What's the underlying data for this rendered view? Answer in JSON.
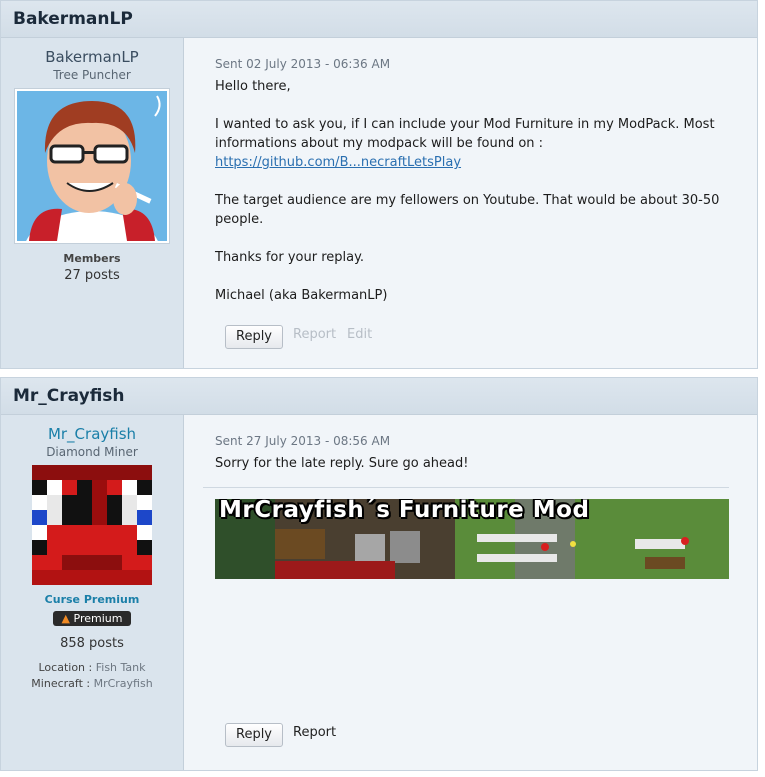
{
  "posts": [
    {
      "header": "BakermanLP",
      "author": {
        "name": "BakermanLP",
        "title": "Tree Puncher",
        "group": "Members",
        "posts": "27 posts"
      },
      "sent": "Sent 02 July 2013 - 06:36 AM",
      "paragraphs": [
        "Hello there,",
        "I wanted to ask you, if I can include your Mod Furniture  in my ModPack. Most informations about my modpack will be found on :",
        "https://github.com/B...necraftLetsPlay",
        "The target audience are my fellowers on Youtube. That would be about 30-50 people.",
        "Thanks for your replay.",
        "Michael (aka BakermanLP)"
      ],
      "actions": {
        "reply": "Reply",
        "report": "Report",
        "edit": "Edit"
      }
    },
    {
      "header": "Mr_Crayfish",
      "author": {
        "name": "Mr_Crayfish",
        "title": "Diamond Miner",
        "group": "Curse Premium",
        "badge": "Premium",
        "posts": "858 posts",
        "location_label": "Location :",
        "location": "Fish Tank",
        "minecraft_label": "Minecraft :",
        "minecraft": "MrCrayfish"
      },
      "sent": "Sent 27 July 2013 - 08:56 AM",
      "paragraphs": [
        "Sorry for the late reply. Sure go ahead!"
      ],
      "banner_text": "MrCrayfish´s Furniture Mod",
      "actions": {
        "reply": "Reply",
        "report": "Report"
      }
    }
  ],
  "colors": {
    "link": "#2a6fb0",
    "premium": "#1a7fa8",
    "accent_red": "#d8201a"
  }
}
